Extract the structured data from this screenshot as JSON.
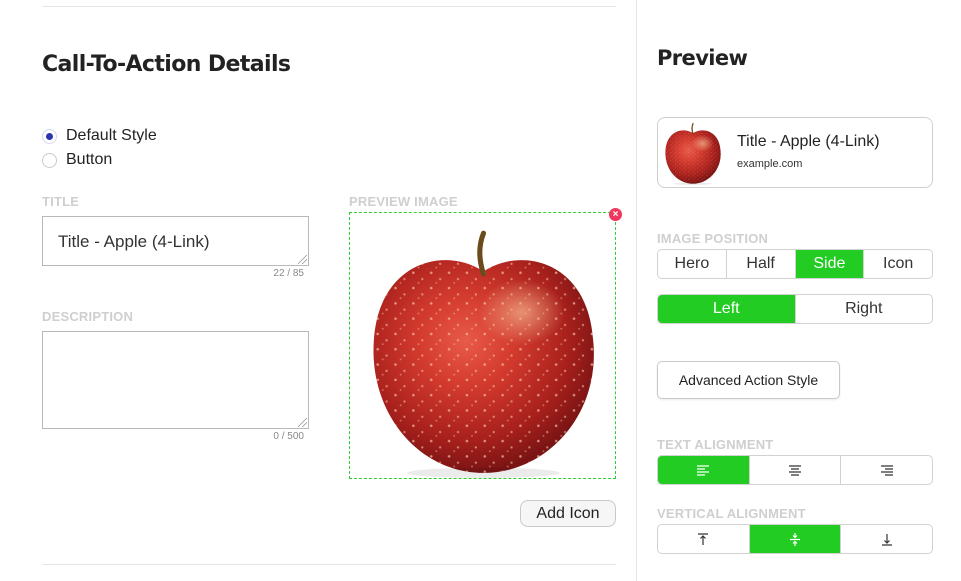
{
  "main": {
    "heading": "Call-To-Action Details",
    "style_options": [
      {
        "label": "Default Style",
        "selected": true
      },
      {
        "label": "Button",
        "selected": false
      }
    ],
    "title_field": {
      "label": "TITLE",
      "value": "Title - Apple (4-Link)",
      "counter": "22 / 85"
    },
    "description_field": {
      "label": "DESCRIPTION",
      "value": "",
      "counter": "0 / 500"
    },
    "preview_image": {
      "label": "PREVIEW IMAGE",
      "remove_glyph": "×",
      "image": "red-apple"
    },
    "add_icon_label": "Add Icon"
  },
  "preview": {
    "heading": "Preview",
    "card": {
      "title": "Title - Apple (4-Link)",
      "domain": "example.com",
      "image": "red-apple"
    },
    "image_position": {
      "label": "IMAGE POSITION",
      "options": [
        "Hero",
        "Half",
        "Side",
        "Icon"
      ],
      "selected": "Side"
    },
    "side": {
      "options": [
        "Left",
        "Right"
      ],
      "selected": "Left"
    },
    "advanced_action_style": "Advanced Action Style",
    "text_alignment": {
      "label": "TEXT ALIGNMENT",
      "options": [
        "align-left-icon",
        "align-center-icon",
        "align-right-icon"
      ],
      "selected": "align-left-icon"
    },
    "vertical_alignment": {
      "label": "VERTICAL ALIGNMENT",
      "options": [
        "align-top-icon",
        "align-middle-icon",
        "align-bottom-icon"
      ],
      "selected": "align-middle-icon"
    }
  },
  "colors": {
    "accent_green": "#22cc22",
    "radio_blue": "#2b35b0",
    "remove_red": "#f0365c"
  }
}
